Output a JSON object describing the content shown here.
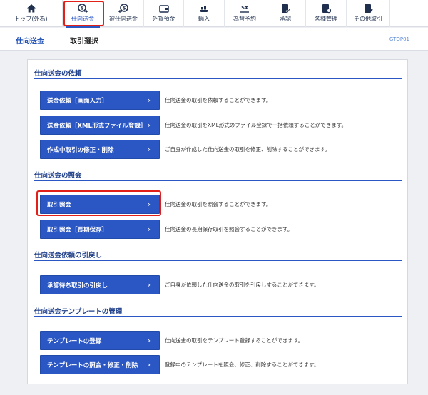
{
  "nav": {
    "items": [
      {
        "label": "トップ(外為)",
        "icon": "home-icon"
      },
      {
        "label": "仕向送金",
        "icon": "outgoing-remittance-icon"
      },
      {
        "label": "被仕向送金",
        "icon": "incoming-remittance-icon"
      },
      {
        "label": "外貨預金",
        "icon": "foreign-deposit-icon"
      },
      {
        "label": "輸入",
        "icon": "import-icon"
      },
      {
        "label": "為替予約",
        "icon": "fx-contract-icon"
      },
      {
        "label": "承認",
        "icon": "approval-icon"
      },
      {
        "label": "各種管理",
        "icon": "management-icon"
      },
      {
        "label": "その他取引",
        "icon": "other-transactions-icon"
      }
    ],
    "active_index": 1
  },
  "titlebar": {
    "section": "仕向送金",
    "page": "取引選択",
    "screen_id": "GTOP01"
  },
  "sections": [
    {
      "heading": "仕向送金の依頼",
      "actions": [
        {
          "label": "送金依頼［画面入力］",
          "desc": "仕向送金の取引を依頼することができます。"
        },
        {
          "label": "送金依頼［XML形式ファイル登録］",
          "desc": "仕向送金の取引をXML形式のファイル登録で一括依頼することができます。"
        },
        {
          "label": "作成中取引の修正・削除",
          "desc": "ご自身が作成した仕向送金の取引を修正、削除することができます。"
        }
      ]
    },
    {
      "heading": "仕向送金の照会",
      "actions": [
        {
          "label": "取引照会",
          "desc": "仕向送金の取引を照会することができます。"
        },
        {
          "label": "取引照会［長期保存］",
          "desc": "仕向送金の長期保存取引を照会することができます。"
        }
      ]
    },
    {
      "heading": "仕向送金依頼の引戻し",
      "actions": [
        {
          "label": "承認待ち取引の引戻し",
          "desc": "ご自身が依頼した仕向送金の取引を引戻しすることができます。"
        }
      ]
    },
    {
      "heading": "仕向送金テンプレートの管理",
      "actions": [
        {
          "label": "テンプレートの登録",
          "desc": "仕向送金の取引をテンプレート登録することができます。"
        },
        {
          "label": "テンプレートの照会・修正・削除",
          "desc": "登録中のテンプレートを照会、修正、削除することができます。"
        }
      ]
    }
  ],
  "chevron": "›",
  "colors": {
    "accent": "#2b57c5",
    "highlight": "#e2201a",
    "heading": "#1f3f8a"
  }
}
